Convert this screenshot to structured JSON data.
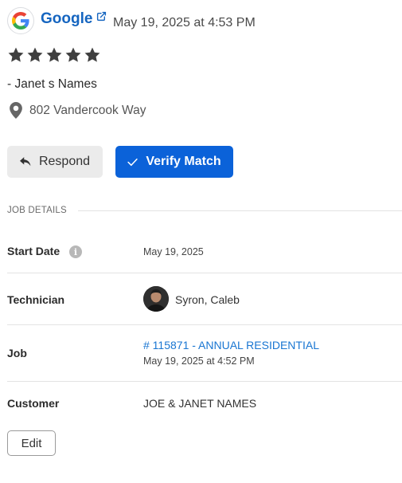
{
  "review": {
    "source_name": "Google",
    "date": "May 19, 2025 at 4:53 PM",
    "rating": 5,
    "rating_max": 5,
    "reviewer": "- Janet s Names",
    "location": "802 Vandercook Way"
  },
  "actions": {
    "respond_label": "Respond",
    "verify_label": "Verify Match",
    "edit_label": "Edit"
  },
  "job_details": {
    "section_title": "JOB DETAILS",
    "start_date_label": "Start Date",
    "start_date_value": "May 19, 2025",
    "info_glyph": "i",
    "technician_label": "Technician",
    "technician_name": "Syron, Caleb",
    "job_label": "Job",
    "job_link": "# 115871 - ANNUAL RESIDENTIAL",
    "job_date": "May 19, 2025 at 4:52 PM",
    "customer_label": "Customer",
    "customer_name": "JOE & JANET NAMES"
  },
  "colors": {
    "brand_blue": "#0b62d9",
    "link_blue": "#1976d2",
    "star": "#3f3f3f"
  },
  "icons": {
    "source": "google-logo-icon",
    "external": "external-link-icon",
    "star": "star-icon",
    "location": "map-pin-icon",
    "respond": "reply-icon",
    "verify": "checkmark-icon",
    "info": "info-icon"
  }
}
